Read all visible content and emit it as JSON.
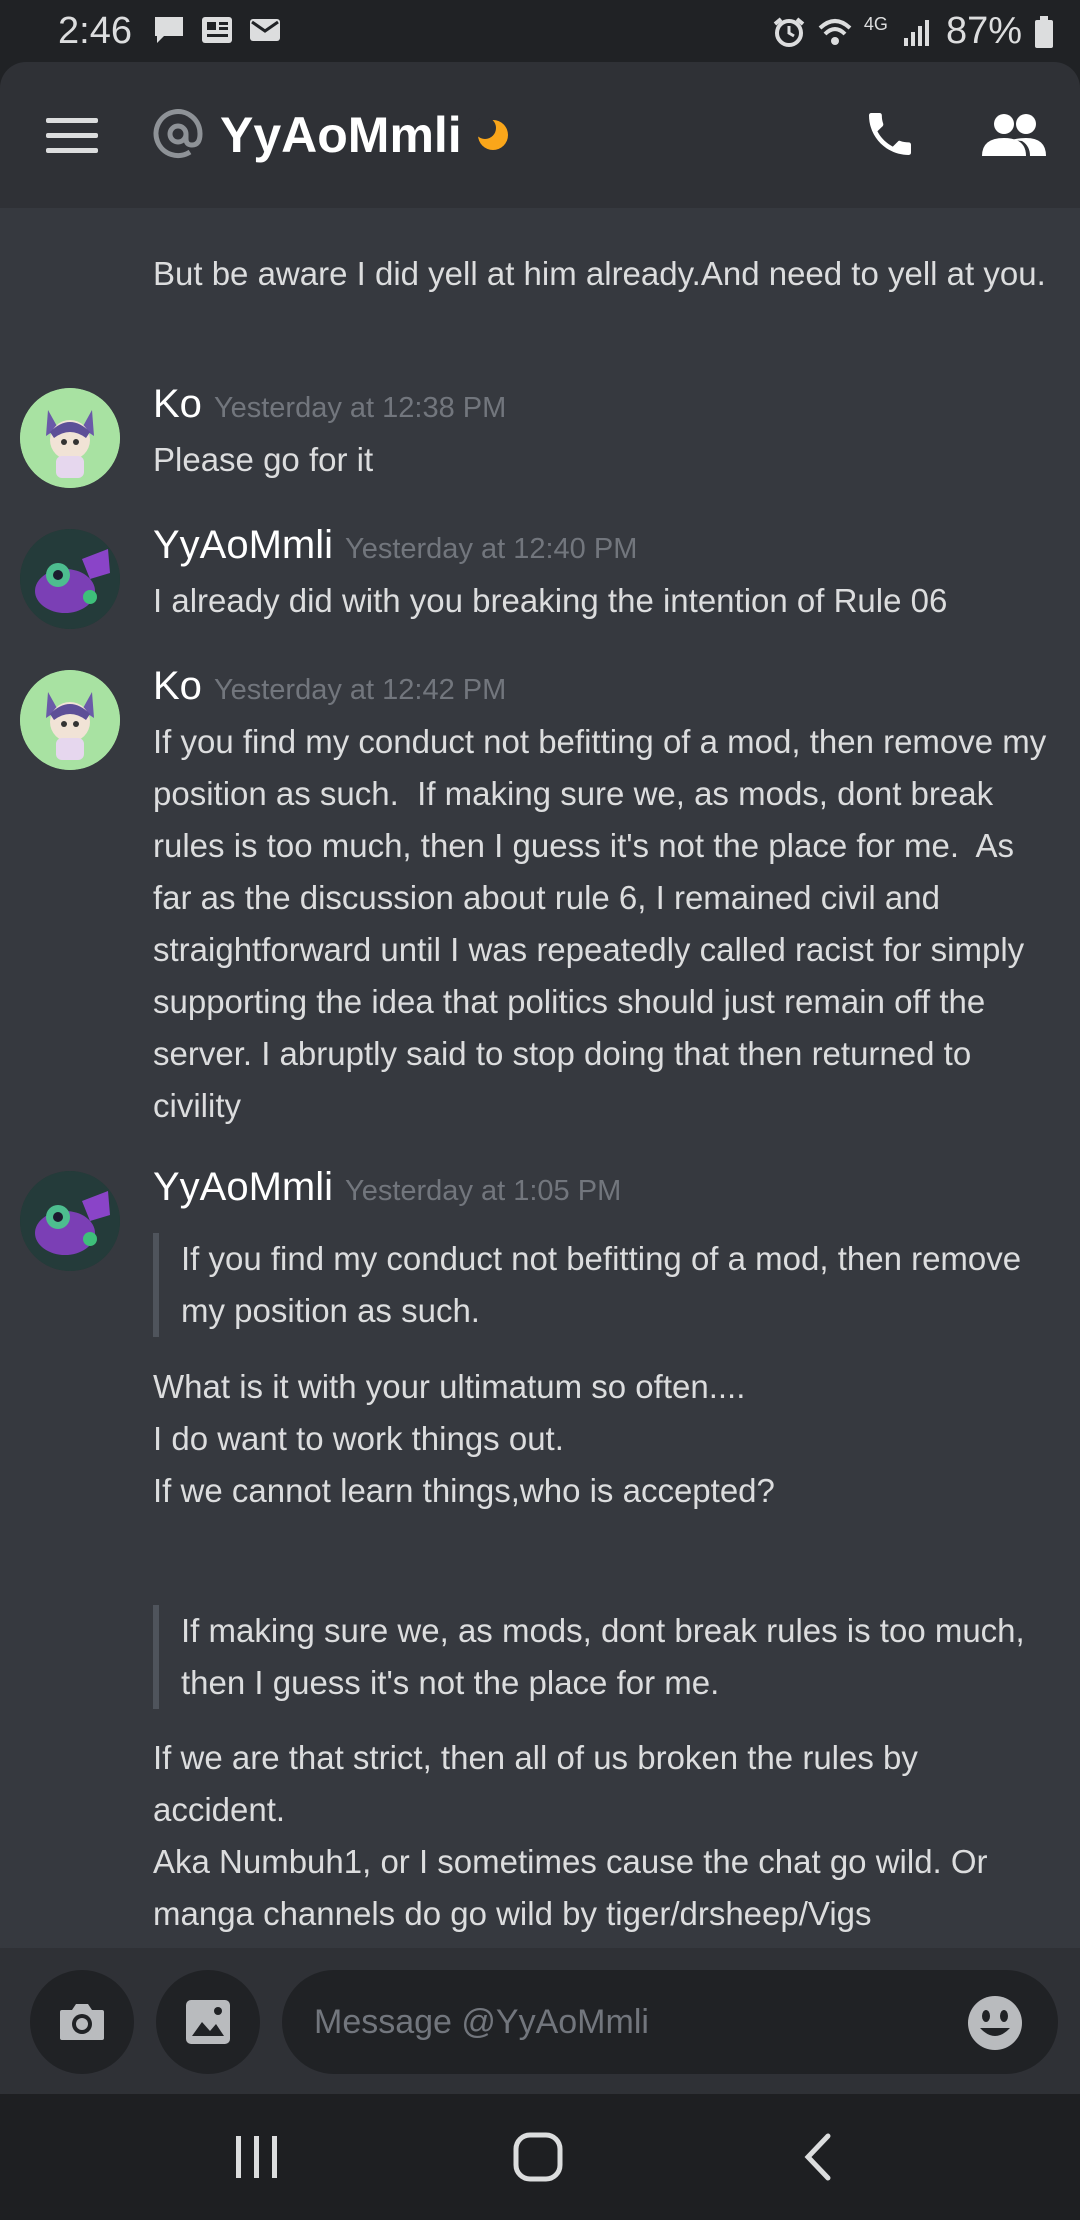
{
  "status_bar": {
    "time": "2:46",
    "network": "4G",
    "battery": "87%",
    "left_icons": [
      "chat-bubble-icon",
      "news-icon",
      "mail-icon"
    ],
    "right_icons": [
      "alarm-icon",
      "wifi-icon",
      "signal-icon",
      "battery-icon"
    ]
  },
  "header": {
    "title": "YyAoMmli",
    "status": "idle",
    "icons": [
      "menu-icon",
      "at-icon",
      "moon-icon",
      "call-icon",
      "members-icon"
    ]
  },
  "messages": {
    "continuation": {
      "text": "But be aware I did yell at him already.And need to yell at you."
    },
    "groups": [
      {
        "author": "Ko",
        "timestamp": "Yesterday at 12:38 PM",
        "text": "Please go for it"
      },
      {
        "author": "YyAoMmli",
        "timestamp": "Yesterday at 12:40 PM",
        "text": "I already did with you breaking the intention of Rule 06"
      },
      {
        "author": "Ko",
        "timestamp": "Yesterday at 12:42 PM",
        "text": "If you find my conduct not befitting of a mod, then remove my position as such.  If making sure we, as mods, dont break rules is too much, then I guess it's not the place for me.  As far as the discussion about rule 6, I remained civil and straightforward until I was repeatedly called racist for simply supporting the idea that politics should just remain off the server. I abruptly said to stop doing that then returned to civility"
      },
      {
        "author": "YyAoMmli",
        "timestamp": "Yesterday at 1:05 PM",
        "quote1": "If you find my conduct not befitting of a mod, then remove my position as such.",
        "reply1": "What is it with your ultimatum so often....\nI do want to work things out.\nIf we cannot learn things,who is accepted?",
        "quote2": "If making sure we, as mods, dont break rules is too much, then I guess it's not the place for me.",
        "reply2": "If we are that strict, then all of us broken the rules by accident.\nAka Numbuh1, or I sometimes cause the chat go wild. Or manga channels do go wild by tiger/drsheep/Vigs"
      }
    ]
  },
  "composer": {
    "placeholder": "Message @YyAoMmli",
    "icons": [
      "camera-icon",
      "image-icon",
      "emoji-icon"
    ]
  },
  "nav_bar": {
    "icons": [
      "recent-apps-icon",
      "home-icon",
      "back-icon"
    ]
  },
  "colors": {
    "background": "#36393f",
    "header": "#2f3136",
    "status_bar": "#202225",
    "idle_moon": "#faa61a",
    "muted_text": "#72767d",
    "quote_bar": "#4f545c"
  }
}
